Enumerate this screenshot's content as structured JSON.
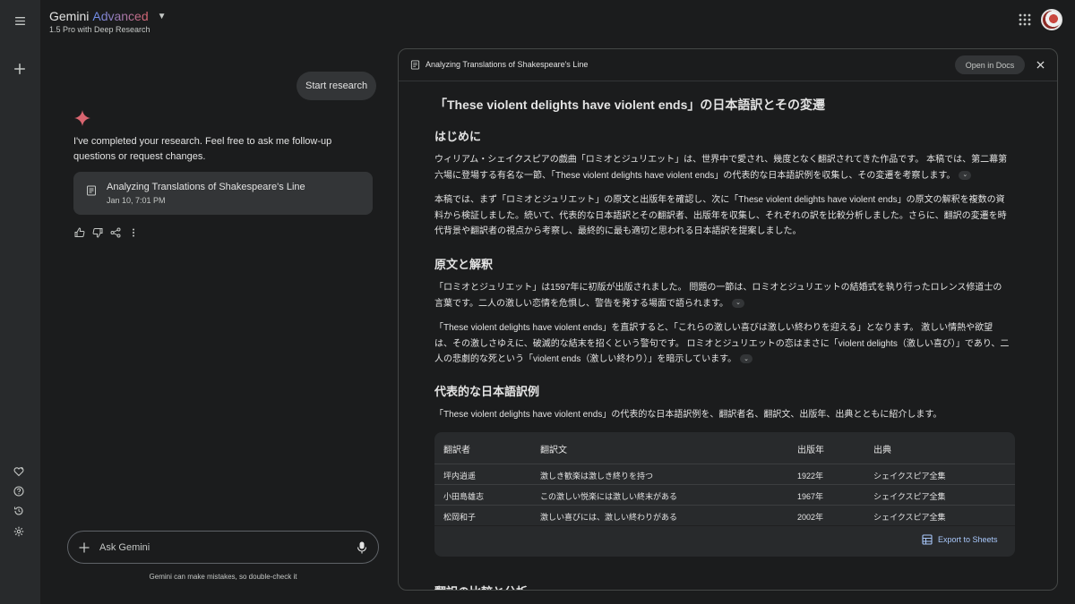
{
  "header": {
    "brand_name": "Gemini",
    "brand_tier": "Advanced",
    "model": "1.5 Pro with Deep Research"
  },
  "chat": {
    "user_message": "Start research",
    "reply": "I've completed your research. Feel free to ask me follow-up questions or request changes.",
    "doc_card": {
      "title": "Analyzing Translations of Shakespeare's Line",
      "date": "Jan 10, 7:01 PM"
    }
  },
  "input": {
    "placeholder": "Ask Gemini",
    "disclaimer": "Gemini can make mistakes, so double-check it"
  },
  "panel": {
    "title": "Analyzing Translations of Shakespeare's Line",
    "open_docs": "Open in Docs",
    "doc_title": "「These violent delights have violent ends」の日本語訳とその変遷",
    "sections": {
      "intro_heading": "はじめに",
      "intro_p1": "ウィリアム・シェイクスピアの戯曲「ロミオとジュリエット」は、世界中で愛され、幾度となく翻訳されてきた作品です。 本稿では、第二幕第六場に登場する有名な一節、「These violent delights have violent ends」の代表的な日本語訳例を収集し、その変遷を考察します。",
      "intro_p2": "本稿では、まず「ロミオとジュリエット」の原文と出版年を確認し、次に「These violent delights have violent ends」の原文の解釈を複数の資料から検証しました。続いて、代表的な日本語訳とその翻訳者、出版年を収集し、それぞれの訳を比較分析しました。さらに、翻訳の変遷を時代背景や翻訳者の視点から考察し、最終的に最も適切と思われる日本語訳を提案しました。",
      "orig_heading": "原文と解釈",
      "orig_p1": "「ロミオとジュリエット」は1597年に初版が出版されました。 問題の一節は、ロミオとジュリエットの結婚式を執り行ったロレンス修道士の言葉です。二人の激しい恋情を危惧し、警告を発する場面で語られます。",
      "orig_p2": "「These violent delights have violent ends」を直訳すると、「これらの激しい喜びは激しい終わりを迎える」となります。 激しい情熱や欲望は、その激しさゆえに、破滅的な結末を招くという警句です。 ロミオとジュリエットの恋はまさに「violent delights（激しい喜び）」であり、二人の悲劇的な死という「violent ends（激しい終わり）」を暗示しています。",
      "examples_heading": "代表的な日本語訳例",
      "examples_p": "「These violent delights have violent ends」の代表的な日本語訳例を、翻訳者名、翻訳文、出版年、出典とともに紹介します。",
      "next_heading": "翻訳の比較と分析"
    },
    "table": {
      "headers": [
        "翻訳者",
        "翻訳文",
        "出版年",
        "出典"
      ],
      "rows": [
        [
          "坪内逍遥",
          "激しき歓楽は激しき終りを持つ",
          "1922年",
          "シェイクスピア全集"
        ],
        [
          "小田島雄志",
          "この激しい悦楽には激しい終末がある",
          "1967年",
          "シェイクスピア全集"
        ],
        [
          "松岡和子",
          "激しい喜びには、激しい終わりがある",
          "2002年",
          "シェイクスピア全集"
        ]
      ],
      "export": "Export to Sheets"
    }
  },
  "colors": {
    "background": "#1b1c1d",
    "rail": "#282a2c",
    "accent_link": "#a8c7fa",
    "spark": "#d96570"
  }
}
